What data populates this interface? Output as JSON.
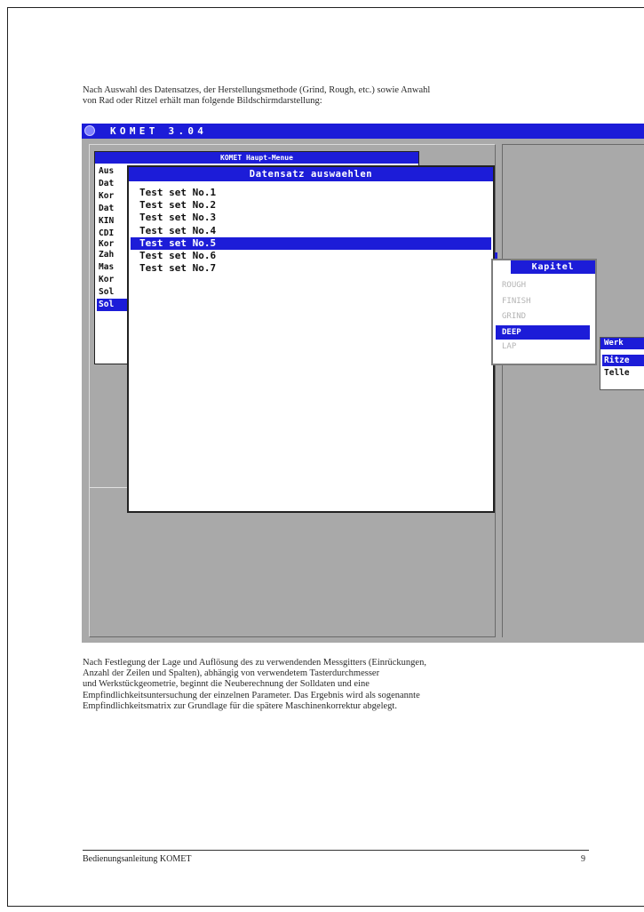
{
  "intro_text": [
    "Nach Auswahl des Datensatzes, der Herstellungsmethode (Grind, Rough, etc.) sowie Anwahl",
    "von Rad oder Ritzel erhält man folgende Bildschirmdarstellung:"
  ],
  "screen": {
    "app_title": "KOMET 3.04",
    "haupt_menue": {
      "title": "KOMET Haupt-Menue",
      "items": [
        "Aus",
        "Dat",
        "Kor",
        "Dat",
        "KIN",
        "CDI",
        "Kor",
        "Zah",
        "Mas",
        "Kor",
        "Sol",
        "Sol"
      ],
      "selected_index": 11
    },
    "datensatz": {
      "title": "Datensatz auswaehlen",
      "items": [
        "Test set No.1",
        "Test set No.2",
        "Test set No.3",
        "Test set No.4",
        "Test set No.5",
        "Test set No.6",
        "Test set No.7"
      ],
      "selected_index": 4
    },
    "kapitel": {
      "title": "Kapitel",
      "items": [
        "ROUGH",
        "FINISH",
        "GRIND",
        "DEEP",
        "LAP"
      ],
      "selected_index": 3
    },
    "werkstueck": {
      "title": "Werk",
      "items": [
        "Ritze",
        "Telle"
      ],
      "selected_index": 0
    },
    "colors": {
      "title_bar": "#1c1cd8",
      "background": "#a9a9a9"
    }
  },
  "body_text": [
    "Nach Festlegung der Lage und Auflösung des zu verwendenden Messgitters (Einrückungen,",
    "Anzahl der Zeilen und Spalten), abhängig von verwendetem Tasterdurchmesser",
    "und Werkstückgeometrie, beginnt die Neuberechnung der Solldaten und eine",
    "Empfindlichkeitsuntersuchung der einzelnen Parameter. Das Ergebnis wird als sogenannte",
    "Empfindlichkeitsmatrix zur Grundlage für die spätere Maschinenkorrektur abgelegt."
  ],
  "footer": {
    "title": "Bedienungsanleitung KOMET",
    "page_number": "9"
  }
}
